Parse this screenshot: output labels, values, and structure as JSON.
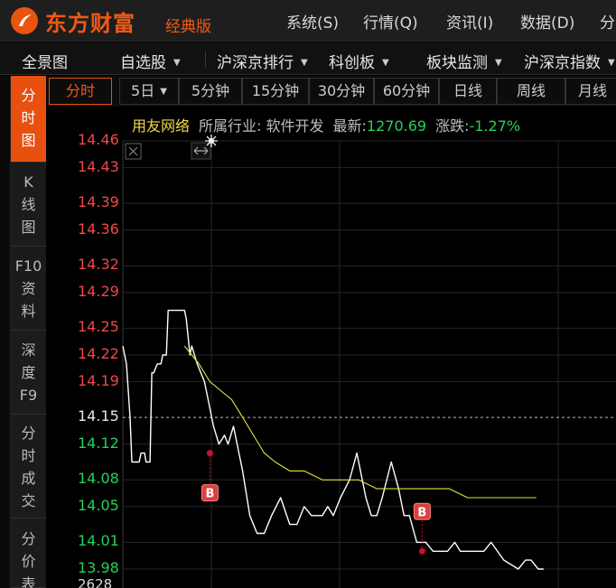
{
  "titlebar": {
    "app_name": "东方财富",
    "edition": "经典版",
    "menu": [
      "系统(S)",
      "行情(Q)",
      "资讯(I)",
      "数据(D)",
      "分"
    ]
  },
  "navbar": {
    "items": [
      {
        "label": "全景图",
        "dropdown": false
      },
      {
        "label": "自选股",
        "dropdown": true
      },
      {
        "label": "沪深京排行",
        "dropdown": true
      },
      {
        "label": "科创板",
        "dropdown": true
      },
      {
        "label": "板块监测",
        "dropdown": true
      },
      {
        "label": "沪深京指数",
        "dropdown": true
      }
    ]
  },
  "sidebar": {
    "tabs": [
      {
        "label": "分\n时\n图",
        "active": true
      },
      {
        "label": "K\n线\n图",
        "active": false
      },
      {
        "label": "F10\n资\n料",
        "active": false
      },
      {
        "label": "深\n度\nF9",
        "active": false
      },
      {
        "label": "分\n时\n成\n交",
        "active": false
      },
      {
        "label": "分\n价\n表",
        "active": false
      }
    ]
  },
  "periods": [
    {
      "label": "分时",
      "active": true
    },
    {
      "label": "5日",
      "dropdown": true
    },
    {
      "label": "5分钟"
    },
    {
      "label": "15分钟"
    },
    {
      "label": "30分钟"
    },
    {
      "label": "60分钟"
    },
    {
      "label": "日线"
    },
    {
      "label": "周线"
    },
    {
      "label": "月线"
    }
  ],
  "info": {
    "stock_name": "用友网络",
    "industry": "所属行业: 软件开发",
    "latest_label": "最新:",
    "latest_value": "1270.69",
    "change_label": "涨跌:",
    "change_value": "-1.27%"
  },
  "colors": {
    "up": "#f04848",
    "down": "#27d05a",
    "neutral": "#e6e6e6",
    "accent": "#e8500f",
    "price_line": "#ffffff",
    "avg_line": "#e6e23a",
    "marker": "#c8102e"
  },
  "chart_data": {
    "type": "line",
    "y_ticks": [
      "14.46",
      "14.43",
      "14.39",
      "14.36",
      "14.32",
      "14.29",
      "14.25",
      "14.22",
      "14.19",
      "14.15",
      "14.12",
      "14.08",
      "14.05",
      "14.01",
      "13.98"
    ],
    "prev_close": 14.15,
    "ylim": [
      13.98,
      14.46
    ],
    "x_range": [
      0,
      240
    ],
    "series": [
      {
        "points": [
          [
            0,
            14.23
          ],
          [
            2,
            14.21
          ],
          [
            4,
            14.15
          ],
          [
            5,
            14.1
          ],
          [
            9,
            14.1
          ],
          [
            10,
            14.11
          ],
          [
            12,
            14.11
          ],
          [
            12.8,
            14.1
          ],
          [
            15,
            14.1
          ],
          [
            16,
            14.2
          ],
          [
            17,
            14.2
          ],
          [
            19,
            14.21
          ],
          [
            21,
            14.21
          ],
          [
            22,
            14.22
          ],
          [
            24,
            14.22
          ],
          [
            25,
            14.27
          ],
          [
            34,
            14.27
          ],
          [
            35,
            14.26
          ],
          [
            36,
            14.24
          ],
          [
            37,
            14.22
          ],
          [
            38,
            14.23
          ],
          [
            41,
            14.21
          ],
          [
            45,
            14.19
          ],
          [
            50,
            14.14
          ],
          [
            53,
            14.12
          ],
          [
            56,
            14.13
          ],
          [
            58,
            14.12
          ],
          [
            61,
            14.14
          ],
          [
            66,
            14.09
          ],
          [
            70,
            14.04
          ],
          [
            74,
            14.02
          ],
          [
            78,
            14.02
          ],
          [
            82,
            14.04
          ],
          [
            87,
            14.06
          ],
          [
            92,
            14.03
          ],
          [
            96,
            14.03
          ],
          [
            100,
            14.05
          ],
          [
            104,
            14.04
          ],
          [
            110,
            14.04
          ],
          [
            113,
            14.05
          ],
          [
            116,
            14.04
          ],
          [
            120,
            14.06
          ],
          [
            125,
            14.08
          ],
          [
            129,
            14.11
          ],
          [
            134,
            14.06
          ],
          [
            137,
            14.04
          ],
          [
            140,
            14.04
          ],
          [
            143,
            14.06
          ],
          [
            148,
            14.1
          ],
          [
            152,
            14.07
          ],
          [
            155,
            14.04
          ],
          [
            158,
            14.04
          ],
          [
            162,
            14.01
          ],
          [
            167,
            14.01
          ],
          [
            171,
            14.0
          ],
          [
            179,
            14.0
          ],
          [
            183,
            14.01
          ],
          [
            186,
            14.0
          ],
          [
            199,
            14.0
          ],
          [
            203,
            14.01
          ],
          [
            210,
            13.99
          ],
          [
            218,
            13.98
          ],
          [
            222,
            13.99
          ],
          [
            225,
            13.99
          ],
          [
            229,
            13.98
          ],
          [
            232,
            13.98
          ]
        ]
      },
      {
        "points": [
          [
            34,
            14.23
          ],
          [
            38,
            14.22
          ],
          [
            42,
            14.21
          ],
          [
            48,
            14.19
          ],
          [
            54,
            14.18
          ],
          [
            60,
            14.17
          ],
          [
            66,
            14.15
          ],
          [
            72,
            14.13
          ],
          [
            78,
            14.11
          ],
          [
            84,
            14.1
          ],
          [
            92,
            14.09
          ],
          [
            100,
            14.09
          ],
          [
            110,
            14.08
          ],
          [
            120,
            14.08
          ],
          [
            130,
            14.08
          ],
          [
            140,
            14.07
          ],
          [
            150,
            14.07
          ],
          [
            160,
            14.07
          ],
          [
            170,
            14.07
          ],
          [
            180,
            14.07
          ],
          [
            190,
            14.06
          ],
          [
            200,
            14.06
          ],
          [
            210,
            14.06
          ],
          [
            220,
            14.06
          ],
          [
            228,
            14.06
          ]
        ]
      }
    ],
    "buy_markers": [
      {
        "x": 48,
        "price": 14.11,
        "label": "B"
      },
      {
        "x": 165,
        "price": 14.0,
        "label": "B"
      }
    ]
  },
  "volume_label": "2628"
}
